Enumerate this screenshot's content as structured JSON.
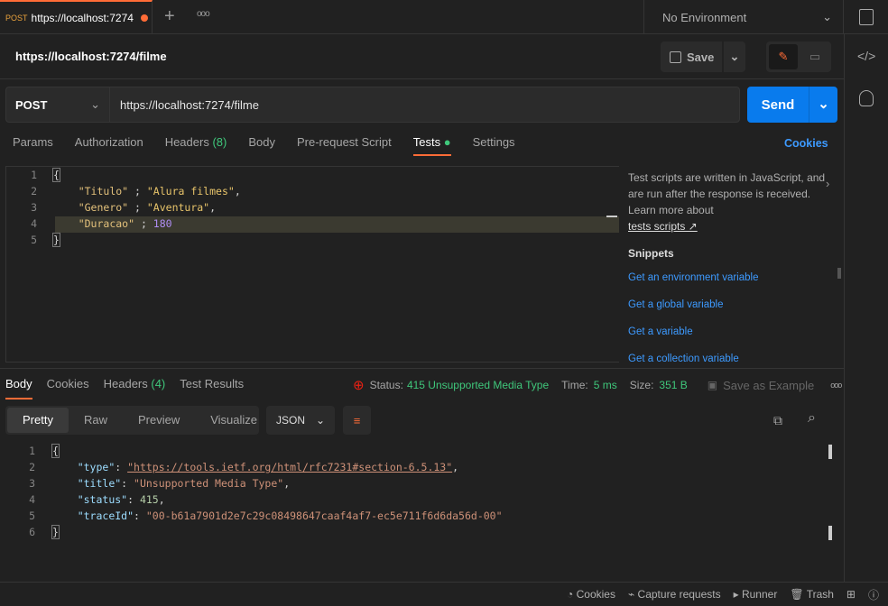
{
  "tab": {
    "method": "POST",
    "title": "https://localhost:7274",
    "unsaved": true
  },
  "environment": "No Environment",
  "request_title": "https://localhost:7274/filme",
  "save_label": "Save",
  "method": "POST",
  "url": "https://localhost:7274/filme",
  "send_label": "Send",
  "request_tabs": {
    "params": "Params",
    "authorization": "Authorization",
    "headers": "Headers",
    "headers_count": "(8)",
    "body": "Body",
    "prerequest": "Pre-request Script",
    "tests": "Tests",
    "settings": "Settings",
    "cookies": "Cookies"
  },
  "request_body": [
    {
      "n": "1",
      "text": "{"
    },
    {
      "n": "2",
      "key": "\"Titulo\"",
      "sep": " ; ",
      "val": "\"Alura filmes\"",
      "end": ","
    },
    {
      "n": "3",
      "key": "\"Genero\"",
      "sep": " ; ",
      "val": "\"Aventura\"",
      "end": ","
    },
    {
      "n": "4",
      "key": "\"Duracao\"",
      "sep": " ; ",
      "num": "180"
    },
    {
      "n": "5",
      "text": "}"
    }
  ],
  "tests_panel": {
    "description": "Test scripts are written in JavaScript, and are run after the response is received. Learn more about",
    "link": "tests scripts ↗",
    "snippets_title": "Snippets",
    "snippets": [
      "Get an environment variable",
      "Get a global variable",
      "Get a variable",
      "Get a collection variable"
    ]
  },
  "response_tabs": {
    "body": "Body",
    "cookies": "Cookies",
    "headers": "Headers",
    "headers_count": "(4)",
    "test_results": "Test Results"
  },
  "status": {
    "label": "Status:",
    "value": "415 Unsupported Media Type",
    "time_label": "Time:",
    "time": "5 ms",
    "size_label": "Size:",
    "size": "351 B",
    "save_example": "Save as Example"
  },
  "view_modes": [
    "Pretty",
    "Raw",
    "Preview",
    "Visualize"
  ],
  "format": "JSON",
  "response_body": [
    {
      "n": "1",
      "text": "{"
    },
    {
      "n": "2",
      "key": "\"type\"",
      "val": "\"https://tools.ietf.org/html/rfc7231#section-6.5.13\"",
      "end": ","
    },
    {
      "n": "3",
      "key": "\"title\"",
      "val": "\"Unsupported Media Type\"",
      "end": ","
    },
    {
      "n": "4",
      "key": "\"status\"",
      "num": "415",
      "end": ","
    },
    {
      "n": "5",
      "key": "\"traceId\"",
      "val": "\"00-b61a7901d2e7c29c08498647caaf4af7-ec5e711f6d6da56d-00\""
    },
    {
      "n": "6",
      "text": "}"
    }
  ],
  "footer": {
    "cookies": "Cookies",
    "capture": "Capture requests",
    "runner": "Runner",
    "trash": "Trash"
  },
  "colors": {
    "accent": "#ff6c37",
    "send": "#097bed",
    "status_ok": "#3fc77b",
    "error": "#eb2013"
  }
}
